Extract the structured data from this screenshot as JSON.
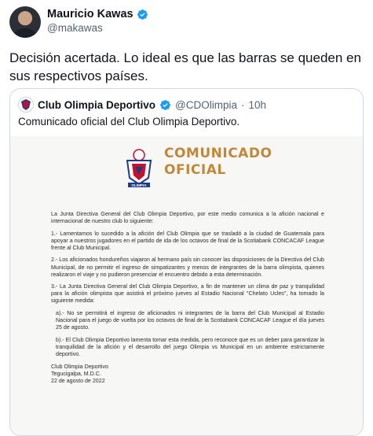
{
  "tweet": {
    "author_name": "Mauricio Kawas",
    "author_handle": "@makawas",
    "text": "Decisión acertada. Lo ideal es que las barras se queden en sus respectivos países."
  },
  "quote": {
    "name": "Club Olimpia Deportivo",
    "handle": "@CDOlimpia",
    "separator": "·",
    "time": "10h",
    "text": "Comunicado oficial del Club Olimpia Deportivo.",
    "image": {
      "title_line1": "COMUNICADO",
      "title_line2": "OFICIAL",
      "logo_text": "OLIMPIA",
      "paragraphs": [
        "La Junta Directiva General del Club Olimpia Deportivo, por este medio comunica a la afición nacional e internacional de nuestro club lo siguiente:",
        "1.- Lamentamos lo sucedido a la afición del Club Olimpia que se trasladó a la ciudad de Guatemala para apoyar a nuestros jugadores en el partido de ida de los octavos de final de la Scotiabank CONCACAF League frente al Club Municipal.",
        "2.- Los aficionados hondureños viajaron al hermano país sin conocer las disposiciones de la Directiva del Club Municipal, de no permitir el ingreso de simpatizantes y menos de integrantes de la barra olimpista, quienes realizaron el viaje y no pudieron presenciar el encuentro debido a esta determinación.",
        "3.- La Junta Directiva General del Club Olimpia Deportivo, a fin de mantener un clima de paz y tranquilidad para la afición olimpista que asistirá el próximo jueves al Estadio Nacional \"Chelato Ucles\", ha tomado la siguiente medida:",
        "a).- No se permitirá el ingreso de aficionados ni integrantes de la barra del Club Municipal al Estadio Nacional para el juego de vuelta por los octavos de final de la Scotiabank CONCACAF League el día jueves 25 de agosto.",
        "b).- El Club Olimpia Deportivo lamenta tomar esta medida, pero reconoce que es un deber para garantizar la tranquilidad de la afición y el desarrollo del juego Olimpia vs Municipal en un ambiente estrictamente deportivo."
      ],
      "signature": [
        "Club Olimpia Deportivo",
        "Tegucigalpa, M.D.C.",
        "22 de agosto de 2022"
      ]
    }
  },
  "colors": {
    "verified": "#1d9bf0",
    "doc_title": "#c1883a",
    "logo_red": "#c8102e",
    "logo_blue": "#1f3c88"
  }
}
